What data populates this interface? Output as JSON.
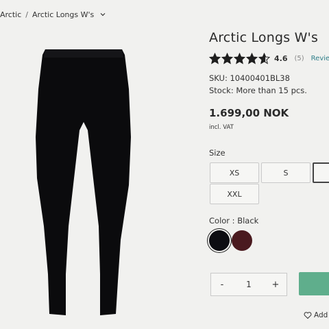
{
  "breadcrumb": {
    "items": [
      "Arctic",
      "Arctic Longs W's"
    ],
    "separator": "/"
  },
  "product": {
    "title": "Arctic Longs W's",
    "rating_value": "4.6",
    "rating_count": "(5)",
    "rating_stars": 4.6,
    "review_link": "Review",
    "sku": "SKU: 10400401BL38",
    "stock": "Stock: More than 15 pcs.",
    "price": "1.699,00 NOK",
    "vat_note": "incl. VAT",
    "image_icon": "leggings-product-image"
  },
  "sizes": {
    "label": "Size",
    "options": [
      "XS",
      "S",
      "",
      "XXL"
    ]
  },
  "colors": {
    "label": "Color : Black",
    "swatches": [
      {
        "name": "black-swatch",
        "hex": "#0d0d12"
      },
      {
        "name": "burgundy-swatch",
        "hex": "#4a1a1f"
      }
    ]
  },
  "quantity": {
    "minus": "-",
    "value": "1",
    "plus": "+"
  },
  "wishlist": {
    "label": "Add"
  },
  "theme": {
    "accent": "#5fae8c",
    "link": "#2f7f8a",
    "star": "#1e1e1e"
  }
}
